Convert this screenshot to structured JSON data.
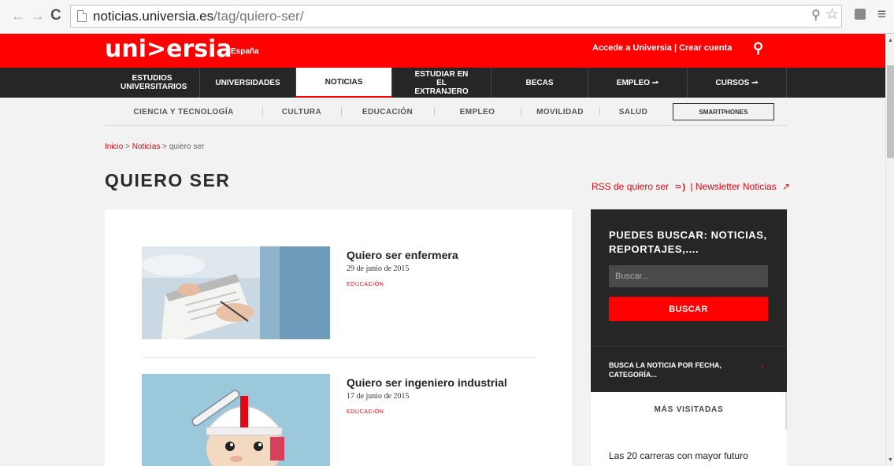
{
  "browser": {
    "url_domain": "noticias.universia.es",
    "url_path": "/tag/quiero-ser/"
  },
  "header": {
    "logo": "uni>ersia",
    "country": "España",
    "access_text": "Accede a Universia | Crear cuenta"
  },
  "nav": {
    "items": [
      {
        "label": "ESTUDIOS UNIVERSITARIOS"
      },
      {
        "label": "UNIVERSIDADES"
      },
      {
        "label": "NOTICIAS"
      },
      {
        "label": "ESTUDIAR EN EL EXTRANJERO"
      },
      {
        "label": "BECAS"
      },
      {
        "label": "EMPLEO ⇀"
      },
      {
        "label": "CURSOS ⇀"
      }
    ]
  },
  "subnav": {
    "items": [
      "CIENCIA Y TECNOLOGÍA",
      "CULTURA",
      "EDUCACIÓN",
      "EMPLEO",
      "MOVILIDAD",
      "SALUD"
    ],
    "smartphones": "SMARTPHONES"
  },
  "breadcrumb": {
    "home": "Inicio",
    "sep1": " > ",
    "news": "Noticias",
    "sep2": " > ",
    "current": "quiero ser"
  },
  "page": {
    "title": "QUIERO SER",
    "rss_label": "RSS de quiero ser",
    "newsletter_label": "| Newsletter Noticias"
  },
  "articles": [
    {
      "title": "Quiero ser enfermera",
      "date": "29 de junio de 2015",
      "category": "EDUCACIÓN"
    },
    {
      "title": "Quiero ser ingeniero industrial",
      "date": "17 de junio de 2015",
      "category": "EDUCACIÓN"
    }
  ],
  "sidebar": {
    "search_title": "PUEDES BUSCAR: NOTICIAS, REPORTAJES,....",
    "search_placeholder": "Buscar...",
    "search_button": "BUSCAR",
    "date_search": "BUSCA LA NOTICIA POR FECHA, CATEGORÍA...",
    "most_visited": "MÁS VISITADAS",
    "top_item": "Las 20 carreras con mayor futuro"
  },
  "icons": {
    "back": "arrow-left-icon",
    "forward": "arrow-right-icon",
    "reload": "reload-icon",
    "search": "search-icon",
    "rss": "rss-icon",
    "external": "external-link-icon"
  },
  "colors": {
    "brand_red": "#ff0000",
    "nav_dark": "#262626",
    "link_red": "#e30613",
    "page_bg": "#f2f2f2"
  }
}
